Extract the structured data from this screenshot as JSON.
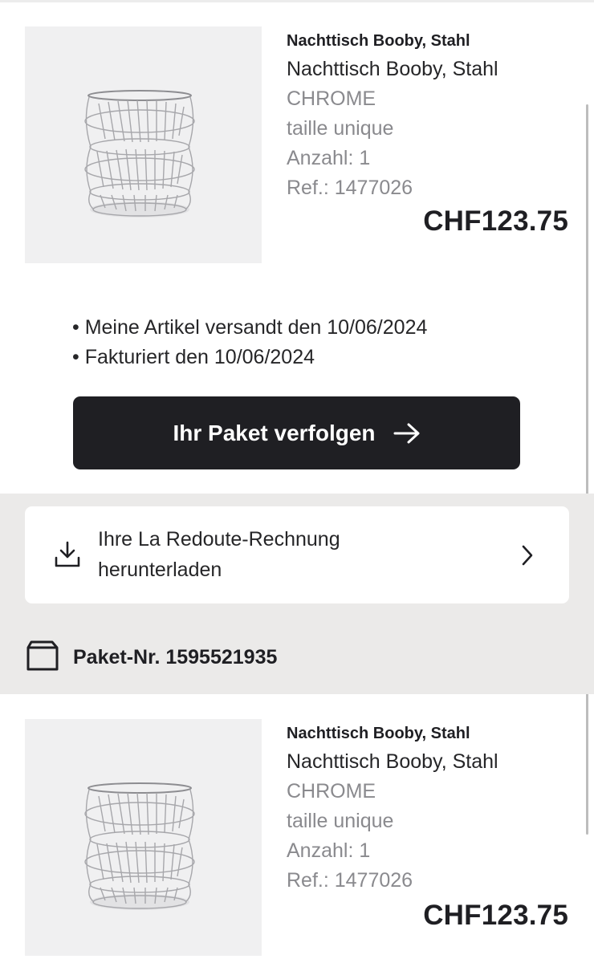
{
  "products": [
    {
      "title_bold": "Nachttisch Booby, Stahl",
      "name": "Nachttisch Booby, Stahl",
      "color": "CHROME",
      "size": "taille unique",
      "quantity": "Anzahl: 1",
      "ref": "Ref.: 1477026",
      "price": "CHF123.75"
    },
    {
      "title_bold": "Nachttisch Booby, Stahl",
      "name": "Nachttisch Booby, Stahl",
      "color": "CHROME",
      "size": "taille unique",
      "quantity": "Anzahl: 1",
      "ref": "Ref.: 1477026",
      "price": "CHF123.75"
    }
  ],
  "shipment": {
    "shipped": "• Meine Artikel versandt den 10/06/2024",
    "invoiced": "• Fakturiert den 10/06/2024"
  },
  "track_button": {
    "label": "Ihr Paket verfolgen",
    "icon": "arrow-right-icon"
  },
  "invoice": {
    "line1": "Ihre La Redoute-Rechnung",
    "line2": "herunterladen",
    "icon": "download-icon"
  },
  "package": {
    "label": "Paket-Nr. 1595521935",
    "icon": "box-icon"
  },
  "colors": {
    "primary": "#1f1f23",
    "muted": "#8a8a8e",
    "band": "#ebeae9",
    "thumb_bg": "#f0f0f1"
  }
}
